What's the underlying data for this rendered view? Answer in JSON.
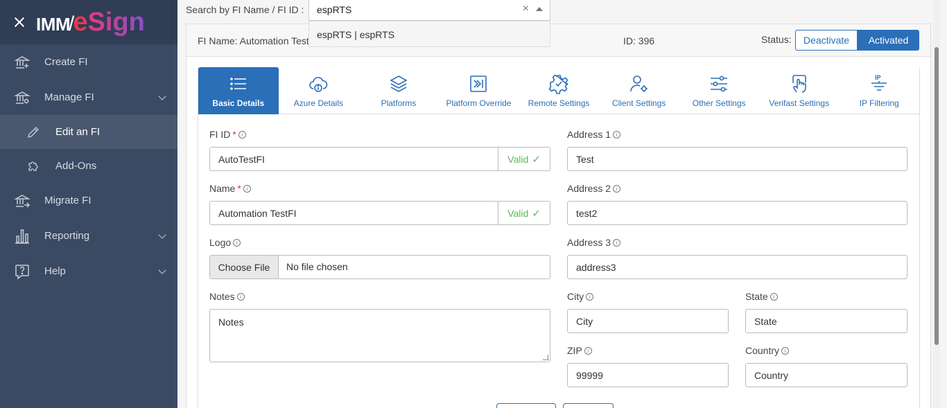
{
  "sidebar": {
    "logo_imm": "IMM",
    "logo_e": "e",
    "logo_sign": "Sign",
    "items": [
      {
        "label": "Create FI",
        "icon": "bank-plus-icon"
      },
      {
        "label": "Manage FI",
        "icon": "bank-gear-icon",
        "expandable": true
      },
      {
        "label": "Edit an FI",
        "icon": "pencil-icon",
        "sub": true,
        "active": true
      },
      {
        "label": "Add-Ons",
        "icon": "puzzle-icon",
        "sub": true
      },
      {
        "label": "Migrate FI",
        "icon": "bank-arrow-icon"
      },
      {
        "label": "Reporting",
        "icon": "bar-chart-icon",
        "expandable": true
      },
      {
        "label": "Help",
        "icon": "question-icon",
        "expandable": true
      }
    ]
  },
  "search": {
    "label": "Search by FI Name / FI ID :",
    "value": "espRTS",
    "clear": "×",
    "option": "espRTS | espRTS"
  },
  "header": {
    "fi_name": "FI Name: Automation TestFI",
    "fi_id": "ID: 396",
    "status_label": "Status:",
    "deactivate": "Deactivate",
    "activated": "Activated"
  },
  "tabs": [
    {
      "label": "Basic Details",
      "icon": "list-icon",
      "active": true
    },
    {
      "label": "Azure Details",
      "icon": "cloud-info-icon"
    },
    {
      "label": "Platforms",
      "icon": "layers-icon"
    },
    {
      "label": "Platform Override",
      "icon": "arrow-in-box-icon"
    },
    {
      "label": "Remote Settings",
      "icon": "gear-outline-icon"
    },
    {
      "label": "Client Settings",
      "icon": "user-gear-icon"
    },
    {
      "label": "Other Settings",
      "icon": "sliders-icon"
    },
    {
      "label": "Verifast Settings",
      "icon": "hand-tap-icon"
    },
    {
      "label": "IP Filtering",
      "icon": "ip-filter-icon",
      "icon_text": "IP"
    }
  ],
  "form": {
    "fi_id": {
      "label": "FI ID",
      "required": "*",
      "value": "AutoTestFI",
      "valid": "Valid",
      "check": "✓"
    },
    "name": {
      "label": "Name",
      "required": "*",
      "value": "Automation TestFI",
      "valid": "Valid",
      "check": "✓"
    },
    "logo": {
      "label": "Logo",
      "button": "Choose File",
      "text": "No file chosen"
    },
    "notes": {
      "label": "Notes",
      "value": "Notes"
    },
    "address1": {
      "label": "Address 1",
      "value": "Test"
    },
    "address2": {
      "label": "Address 2",
      "value": "test2"
    },
    "address3": {
      "label": "Address 3",
      "value": "address3"
    },
    "city": {
      "label": "City",
      "value": "City"
    },
    "state": {
      "label": "State",
      "value": "State"
    },
    "zip": {
      "label": "ZIP",
      "value": "99999"
    },
    "country": {
      "label": "Country",
      "value": "Country"
    },
    "info_glyph": "i"
  },
  "colors": {
    "sidebar_bg": "#3b4a63",
    "accent": "#2a6fb8",
    "valid": "#5cb85c",
    "required": "#d9363e"
  }
}
